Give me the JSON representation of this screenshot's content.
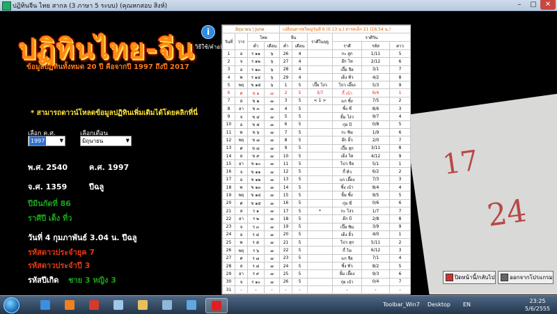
{
  "window": {
    "title": "ปฏิทินจีน ไทย สากล (3 ภาษา 5 ระบบ) (คุณหกสอบ สิงห์)",
    "min": "–",
    "max": "□",
    "close": "✕"
  },
  "header": {
    "logo": "ปฏิทินไทย-จีน",
    "subtitle": "ข้อมูลปฏิทินทั้งหมด 20 ปี คือจากปี 1997 ถึงปี 2017",
    "info_icon": "i",
    "info_label": "วิธีใช้/คำอธิบาย",
    "download_note": "* สามารถดาวน์โหลดข้อมูลปฏิทินเพิ่มเติมได้โดยคลิกที่นี่"
  },
  "controls": {
    "year_label": "เลือก ค.ศ.",
    "year_value": "1997",
    "month_label": "เลือกเดือน",
    "month_value": "มิถุนายน",
    "arrow": "▼"
  },
  "details": {
    "be_year": "พ.ศ. 2540",
    "ad_year": "ค.ศ. 1997",
    "cs_year": "จ.ศ. 1359",
    "zodiac_year": "ปีฉลู",
    "cycle": "ปีมีนกัดที่ 86",
    "year_element": "ราศีปี เต็ง ที่ว",
    "new_year": "วันที่ 4 กุมภาพันธ์ 3.04 น. ปีฉลู",
    "star_era": "รหัสดาวประจำยุค 7",
    "star_year": "รหัสดาวประจำปี 3",
    "birth_label": "รหัสปีเกิด",
    "birth_value": "ชาย 3  หญิง 3"
  },
  "calendar": {
    "month_title": "มิถุนายน | June",
    "moon_note": "เปลี่ยนสารทใหญ่วันที่ 6 (0.13 น.) สารทเล็ก 21 (16.54 น.)",
    "col_day": "วันที่",
    "col_weekday": "วาร",
    "col_thai": "ไทย",
    "col_chinese": "จีน",
    "col_season": "ราศีในฤดู",
    "col_zodiac": "ราศีวัน",
    "sub_thai_date": "ค่ำ",
    "sub_thai_month": "เดือน",
    "sub_cn_date": "ค่ำ",
    "sub_cn_month": "เดือน",
    "sub_zodiac": "ราศี",
    "sub_code": "รหัส",
    "sub_star": "ดาว",
    "rows": [
      {
        "d": "1",
        "w": "อ",
        "td": "ร ๑๑",
        "tm": "๖",
        "cd": "26",
        "cm": "4",
        "s": "",
        "z": "กะ สูก",
        "c": "1/11",
        "st": "5",
        "sun": false
      },
      {
        "d": "2",
        "w": "จ",
        "td": "ร ๑๒",
        "tm": "๖",
        "cd": "27",
        "cm": "4",
        "s": "",
        "z": "อ๊ก โห",
        "c": "2/12",
        "st": "6",
        "sun": false
      },
      {
        "d": "3",
        "w": "อ",
        "td": "ร ๑๓",
        "tm": "๖",
        "cd": "28",
        "cm": "4",
        "s": "",
        "z": "เปี๊ย จือ",
        "c": "3/1",
        "st": "7",
        "sun": false
      },
      {
        "d": "4",
        "w": "พ",
        "td": "ร ๑๔",
        "tm": "๖",
        "cd": "29",
        "cm": "4",
        "s": "",
        "z": "เต็ง ทิ่ว",
        "c": "4/2",
        "st": "8",
        "sun": false
      },
      {
        "d": "5",
        "w": "พฤ",
        "td": "ข ๑๕",
        "tm": "๖",
        "cd": "1",
        "cm": "5",
        "s": "เปี๊ย โง่ว",
        "z": "โบ่ว เอี๊ยง",
        "c": "5/3",
        "st": "9",
        "sun": false
      },
      {
        "d": "6",
        "w": "ศ",
        "td": "ข ๑",
        "tm": "๗",
        "cd": "2",
        "cm": "5",
        "s": "3/7",
        "z": "กี้ เบ้า",
        "c": "6/4",
        "st": "1",
        "sun": true
      },
      {
        "d": "7",
        "w": "ส",
        "td": "ข ๒",
        "tm": "๗",
        "cd": "3",
        "cm": "5",
        "s": "< 1 >",
        "z": "แก ซิ้ง",
        "c": "7/5",
        "st": "2",
        "sun": false
      },
      {
        "d": "8",
        "w": "อา",
        "td": "ข ๓",
        "tm": "๗",
        "cd": "4",
        "cm": "5",
        "s": "",
        "z": "ซิ้ง ชี่",
        "c": "8/6",
        "st": "3",
        "sun": false
      },
      {
        "d": "9",
        "w": "จ",
        "td": "ข ๔",
        "tm": "๗",
        "cd": "5",
        "cm": "5",
        "s": "",
        "z": "ยิ้ม โง่ว",
        "c": "9/7",
        "st": "4",
        "sun": false
      },
      {
        "d": "10",
        "w": "อ",
        "td": "ข ๕",
        "tm": "๗",
        "cd": "6",
        "cm": "5",
        "s": "",
        "z": "กุ่ย บี",
        "c": "0/8",
        "st": "5",
        "sun": false
      },
      {
        "d": "11",
        "w": "พ",
        "td": "ข ๖",
        "tm": "๗",
        "cd": "7",
        "cm": "5",
        "s": "",
        "z": "กะ ซิม",
        "c": "1/9",
        "st": "6",
        "sun": false
      },
      {
        "d": "12",
        "w": "พฤ",
        "td": "ข ๗",
        "tm": "๗",
        "cd": "8",
        "cm": "5",
        "s": "",
        "z": "อ๊ก อิ้ว",
        "c": "2/0",
        "st": "7",
        "sun": false
      },
      {
        "d": "13",
        "w": "ศ",
        "td": "ข ๘",
        "tm": "๗",
        "cd": "9",
        "cm": "5",
        "s": "",
        "z": "เปี๊ย สุก",
        "c": "3/11",
        "st": "8",
        "sun": false
      },
      {
        "d": "14",
        "w": "ส",
        "td": "ข ๙",
        "tm": "๗",
        "cd": "10",
        "cm": "5",
        "s": "",
        "z": "เต็ง โห",
        "c": "4/12",
        "st": "9",
        "sun": false
      },
      {
        "d": "15",
        "w": "อา",
        "td": "ข ๑๐",
        "tm": "๗",
        "cd": "11",
        "cm": "5",
        "s": "",
        "z": "โบ่ว จือ",
        "c": "5/1",
        "st": "1",
        "sun": false
      },
      {
        "d": "16",
        "w": "จ",
        "td": "ข ๑๑",
        "tm": "๗",
        "cd": "12",
        "cm": "5",
        "s": "",
        "z": "กี้ ทิ่ว",
        "c": "6/2",
        "st": "2",
        "sun": false
      },
      {
        "d": "17",
        "w": "อ",
        "td": "ข ๑๒",
        "tm": "๗",
        "cd": "13",
        "cm": "5",
        "s": "",
        "z": "แก เอี๊ยง",
        "c": "7/3",
        "st": "3",
        "sun": false
      },
      {
        "d": "18",
        "w": "พ",
        "td": "ข ๑๓",
        "tm": "๗",
        "cd": "14",
        "cm": "5",
        "s": "",
        "z": "ซิ้ง เบ้า",
        "c": "8/4",
        "st": "4",
        "sun": false
      },
      {
        "d": "19",
        "w": "พฤ",
        "td": "ข ๑๔",
        "tm": "๗",
        "cd": "15",
        "cm": "5",
        "s": "",
        "z": "ยิ้ม ซิ้ง",
        "c": "9/5",
        "st": "5",
        "sun": false
      },
      {
        "d": "20",
        "w": "ศ",
        "td": "ข ๑๕",
        "tm": "๗",
        "cd": "16",
        "cm": "5",
        "s": "",
        "z": "กุ่ย ชี่",
        "c": "0/6",
        "st": "6",
        "sun": false
      },
      {
        "d": "21",
        "w": "ส",
        "td": "ร ๑",
        "tm": "๗",
        "cd": "17",
        "cm": "5",
        "s": "*",
        "z": "กะ โง่ว",
        "c": "1/7",
        "st": "7",
        "sun": false
      },
      {
        "d": "22",
        "w": "อา",
        "td": "ร ๒",
        "tm": "๗",
        "cd": "18",
        "cm": "5",
        "s": "",
        "z": "อ๊ก บี",
        "c": "2/8",
        "st": "8",
        "sun": false
      },
      {
        "d": "23",
        "w": "จ",
        "td": "ร ๓",
        "tm": "๗",
        "cd": "19",
        "cm": "5",
        "s": "",
        "z": "เปี๊ย ซิม",
        "c": "3/9",
        "st": "9",
        "sun": false
      },
      {
        "d": "24",
        "w": "อ",
        "td": "ร ๔",
        "tm": "๗",
        "cd": "20",
        "cm": "5",
        "s": "",
        "z": "เต็ง อิ้ว",
        "c": "4/0",
        "st": "1",
        "sun": false
      },
      {
        "d": "25",
        "w": "พ",
        "td": "ร ๕",
        "tm": "๗",
        "cd": "21",
        "cm": "5",
        "s": "",
        "z": "โบ่ว สุก",
        "c": "5/11",
        "st": "2",
        "sun": false
      },
      {
        "d": "26",
        "w": "พฤ",
        "td": "ร ๖",
        "tm": "๗",
        "cd": "22",
        "cm": "5",
        "s": "",
        "z": "กี้ โห",
        "c": "6/12",
        "st": "3",
        "sun": false
      },
      {
        "d": "27",
        "w": "ศ",
        "td": "ร ๗",
        "tm": "๗",
        "cd": "23",
        "cm": "5",
        "s": "",
        "z": "แก จือ",
        "c": "7/1",
        "st": "4",
        "sun": false
      },
      {
        "d": "28",
        "w": "ส",
        "td": "ร ๘",
        "tm": "๗",
        "cd": "24",
        "cm": "5",
        "s": "",
        "z": "ซิ้ง ทิ่ว",
        "c": "8/2",
        "st": "5",
        "sun": false
      },
      {
        "d": "29",
        "w": "อา",
        "td": "ร ๙",
        "tm": "๗",
        "cd": "25",
        "cm": "5",
        "s": "",
        "z": "ยิ้ม เอี๊ยง",
        "c": "9/3",
        "st": "6",
        "sun": false
      },
      {
        "d": "30",
        "w": "จ",
        "td": "ร ๑๐",
        "tm": "๗",
        "cd": "26",
        "cm": "5",
        "s": "",
        "z": "กุ่ย เบ้า",
        "c": "0/4",
        "st": "7",
        "sun": false
      },
      {
        "d": "31",
        "w": "-",
        "td": "-",
        "tm": "-",
        "cd": "-",
        "cm": "-",
        "s": "",
        "z": "-",
        "c": "-",
        "st": "-",
        "sun": false
      }
    ]
  },
  "buttons": {
    "today": "ปิดหน้านี้/กลับไป",
    "exit": "ออกจากโปรแกรม"
  },
  "taskbar": {
    "toolbar_label": "Toolbar_Win7",
    "desktop_label": "Desktop",
    "lang": "EN",
    "time": "23:25",
    "date": "5/6/2555",
    "apps": [
      {
        "icon": "internet-explorer-icon",
        "color": "#3a8fe0"
      },
      {
        "icon": "media-player-icon",
        "color": "#f08020"
      },
      {
        "icon": "chrome-icon",
        "color": "#d33b2c"
      },
      {
        "icon": "notepad-icon",
        "color": "#9fc7e8"
      },
      {
        "icon": "folder-icon",
        "color": "#e8c05a"
      },
      {
        "icon": "control-panel-icon",
        "color": "#8fb8d8"
      },
      {
        "icon": "paint-icon",
        "color": "#5fa8e0"
      },
      {
        "icon": "calendar-app-icon",
        "color": "#e02020"
      }
    ]
  }
}
